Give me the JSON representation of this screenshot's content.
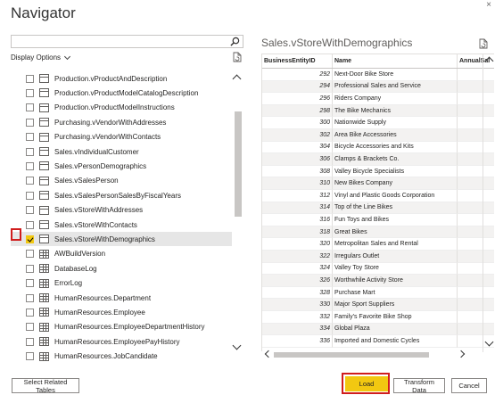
{
  "window": {
    "title": "Navigator",
    "close_glyph": "×"
  },
  "left_panel": {
    "search_placeholder": "",
    "display_options_label": "Display Options",
    "items": [
      {
        "label": "Production.vProductAndDescription",
        "icon": "view",
        "checked": false
      },
      {
        "label": "Production.vProductModelCatalogDescription",
        "icon": "view",
        "checked": false
      },
      {
        "label": "Production.vProductModelInstructions",
        "icon": "view",
        "checked": false
      },
      {
        "label": "Purchasing.vVendorWithAddresses",
        "icon": "view",
        "checked": false
      },
      {
        "label": "Purchasing.vVendorWithContacts",
        "icon": "view",
        "checked": false
      },
      {
        "label": "Sales.vIndividualCustomer",
        "icon": "view",
        "checked": false
      },
      {
        "label": "Sales.vPersonDemographics",
        "icon": "view",
        "checked": false
      },
      {
        "label": "Sales.vSalesPerson",
        "icon": "view",
        "checked": false
      },
      {
        "label": "Sales.vSalesPersonSalesByFiscalYears",
        "icon": "view",
        "checked": false
      },
      {
        "label": "Sales.vStoreWithAddresses",
        "icon": "view",
        "checked": false
      },
      {
        "label": "Sales.vStoreWithContacts",
        "icon": "view",
        "checked": false
      },
      {
        "label": "Sales.vStoreWithDemographics",
        "icon": "view",
        "checked": true
      },
      {
        "label": "AWBuildVersion",
        "icon": "table",
        "checked": false
      },
      {
        "label": "DatabaseLog",
        "icon": "table",
        "checked": false
      },
      {
        "label": "ErrorLog",
        "icon": "table",
        "checked": false
      },
      {
        "label": "HumanResources.Department",
        "icon": "table",
        "checked": false
      },
      {
        "label": "HumanResources.Employee",
        "icon": "table",
        "checked": false
      },
      {
        "label": "HumanResources.EmployeeDepartmentHistory",
        "icon": "table",
        "checked": false
      },
      {
        "label": "HumanResources.EmployeePayHistory",
        "icon": "table",
        "checked": false
      },
      {
        "label": "HumanResources.JobCandidate",
        "icon": "table",
        "checked": false
      }
    ]
  },
  "preview": {
    "title": "Sales.vStoreWithDemographics",
    "columns": [
      "BusinessEntityID",
      "Name",
      "AnnualSal"
    ],
    "rows": [
      [
        "292",
        "Next-Door Bike Store"
      ],
      [
        "294",
        "Professional Sales and Service"
      ],
      [
        "296",
        "Riders Company"
      ],
      [
        "298",
        "The Bike Mechanics"
      ],
      [
        "300",
        "Nationwide Supply"
      ],
      [
        "302",
        "Area Bike Accessories"
      ],
      [
        "304",
        "Bicycle Accessories and Kits"
      ],
      [
        "306",
        "Clamps & Brackets Co."
      ],
      [
        "308",
        "Valley Bicycle Specialists"
      ],
      [
        "310",
        "New Bikes Company"
      ],
      [
        "312",
        "Vinyl and Plastic Goods Corporation"
      ],
      [
        "314",
        "Top of the Line Bikes"
      ],
      [
        "316",
        "Fun Toys and Bikes"
      ],
      [
        "318",
        "Great Bikes"
      ],
      [
        "320",
        "Metropolitan Sales and Rental"
      ],
      [
        "322",
        "Irregulars Outlet"
      ],
      [
        "324",
        "Valley Toy Store"
      ],
      [
        "326",
        "Worthwhile Activity Store"
      ],
      [
        "328",
        "Purchase Mart"
      ],
      [
        "330",
        "Major Sport Suppliers"
      ],
      [
        "332",
        "Family's Favorite Bike Shop"
      ],
      [
        "334",
        "Global Plaza"
      ],
      [
        "336",
        "Imported and Domestic Cycles"
      ]
    ]
  },
  "footer": {
    "select_related_label": "Select Related Tables",
    "load_label": "Load",
    "transform_label": "Transform Data",
    "cancel_label": "Cancel"
  },
  "colors": {
    "accent": "#f2c811",
    "highlight_box": "#d01d1d"
  }
}
